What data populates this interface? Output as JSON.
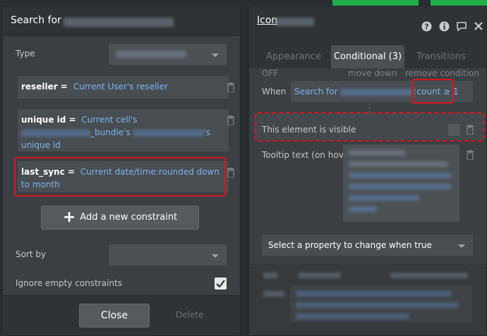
{
  "search_panel": {
    "title": "Search for",
    "type_label": "Type",
    "constraints": [
      {
        "key": "reseller =",
        "value": "Current User's reseller"
      },
      {
        "key": "unique id =",
        "value_a": "Current cell's",
        "value_b": "_bundle's",
        "value_c": "'s",
        "value_d": "unique id"
      },
      {
        "key": "last_sync =",
        "value": "Current date/time:rounded down to month"
      }
    ],
    "add_constraint_label": "Add a new constraint",
    "sort_by_label": "Sort by",
    "ignore_empty_label": "Ignore empty constraints",
    "close_label": "Close",
    "delete_label": "Delete"
  },
  "icon_panel": {
    "title": "Icon",
    "tabs": [
      {
        "label": "Appearance"
      },
      {
        "label": "Conditional (3)"
      },
      {
        "label": "Transitions"
      }
    ],
    "off_label": "OFF",
    "move_down_label": "move down",
    "remove_condition_label": "remove condition",
    "when_label": "When",
    "when_value_a": "Search for",
    "when_value_b": ":count ≥ 1",
    "visible_label": "This element is visible",
    "tooltip_label": "Tooltip text (on hove",
    "select_property_label": "Select a property to change when true"
  },
  "colors": {
    "accent_link": "#7fb3ee",
    "highlight": "#e0141a",
    "top_strip": "#1fae4a"
  }
}
